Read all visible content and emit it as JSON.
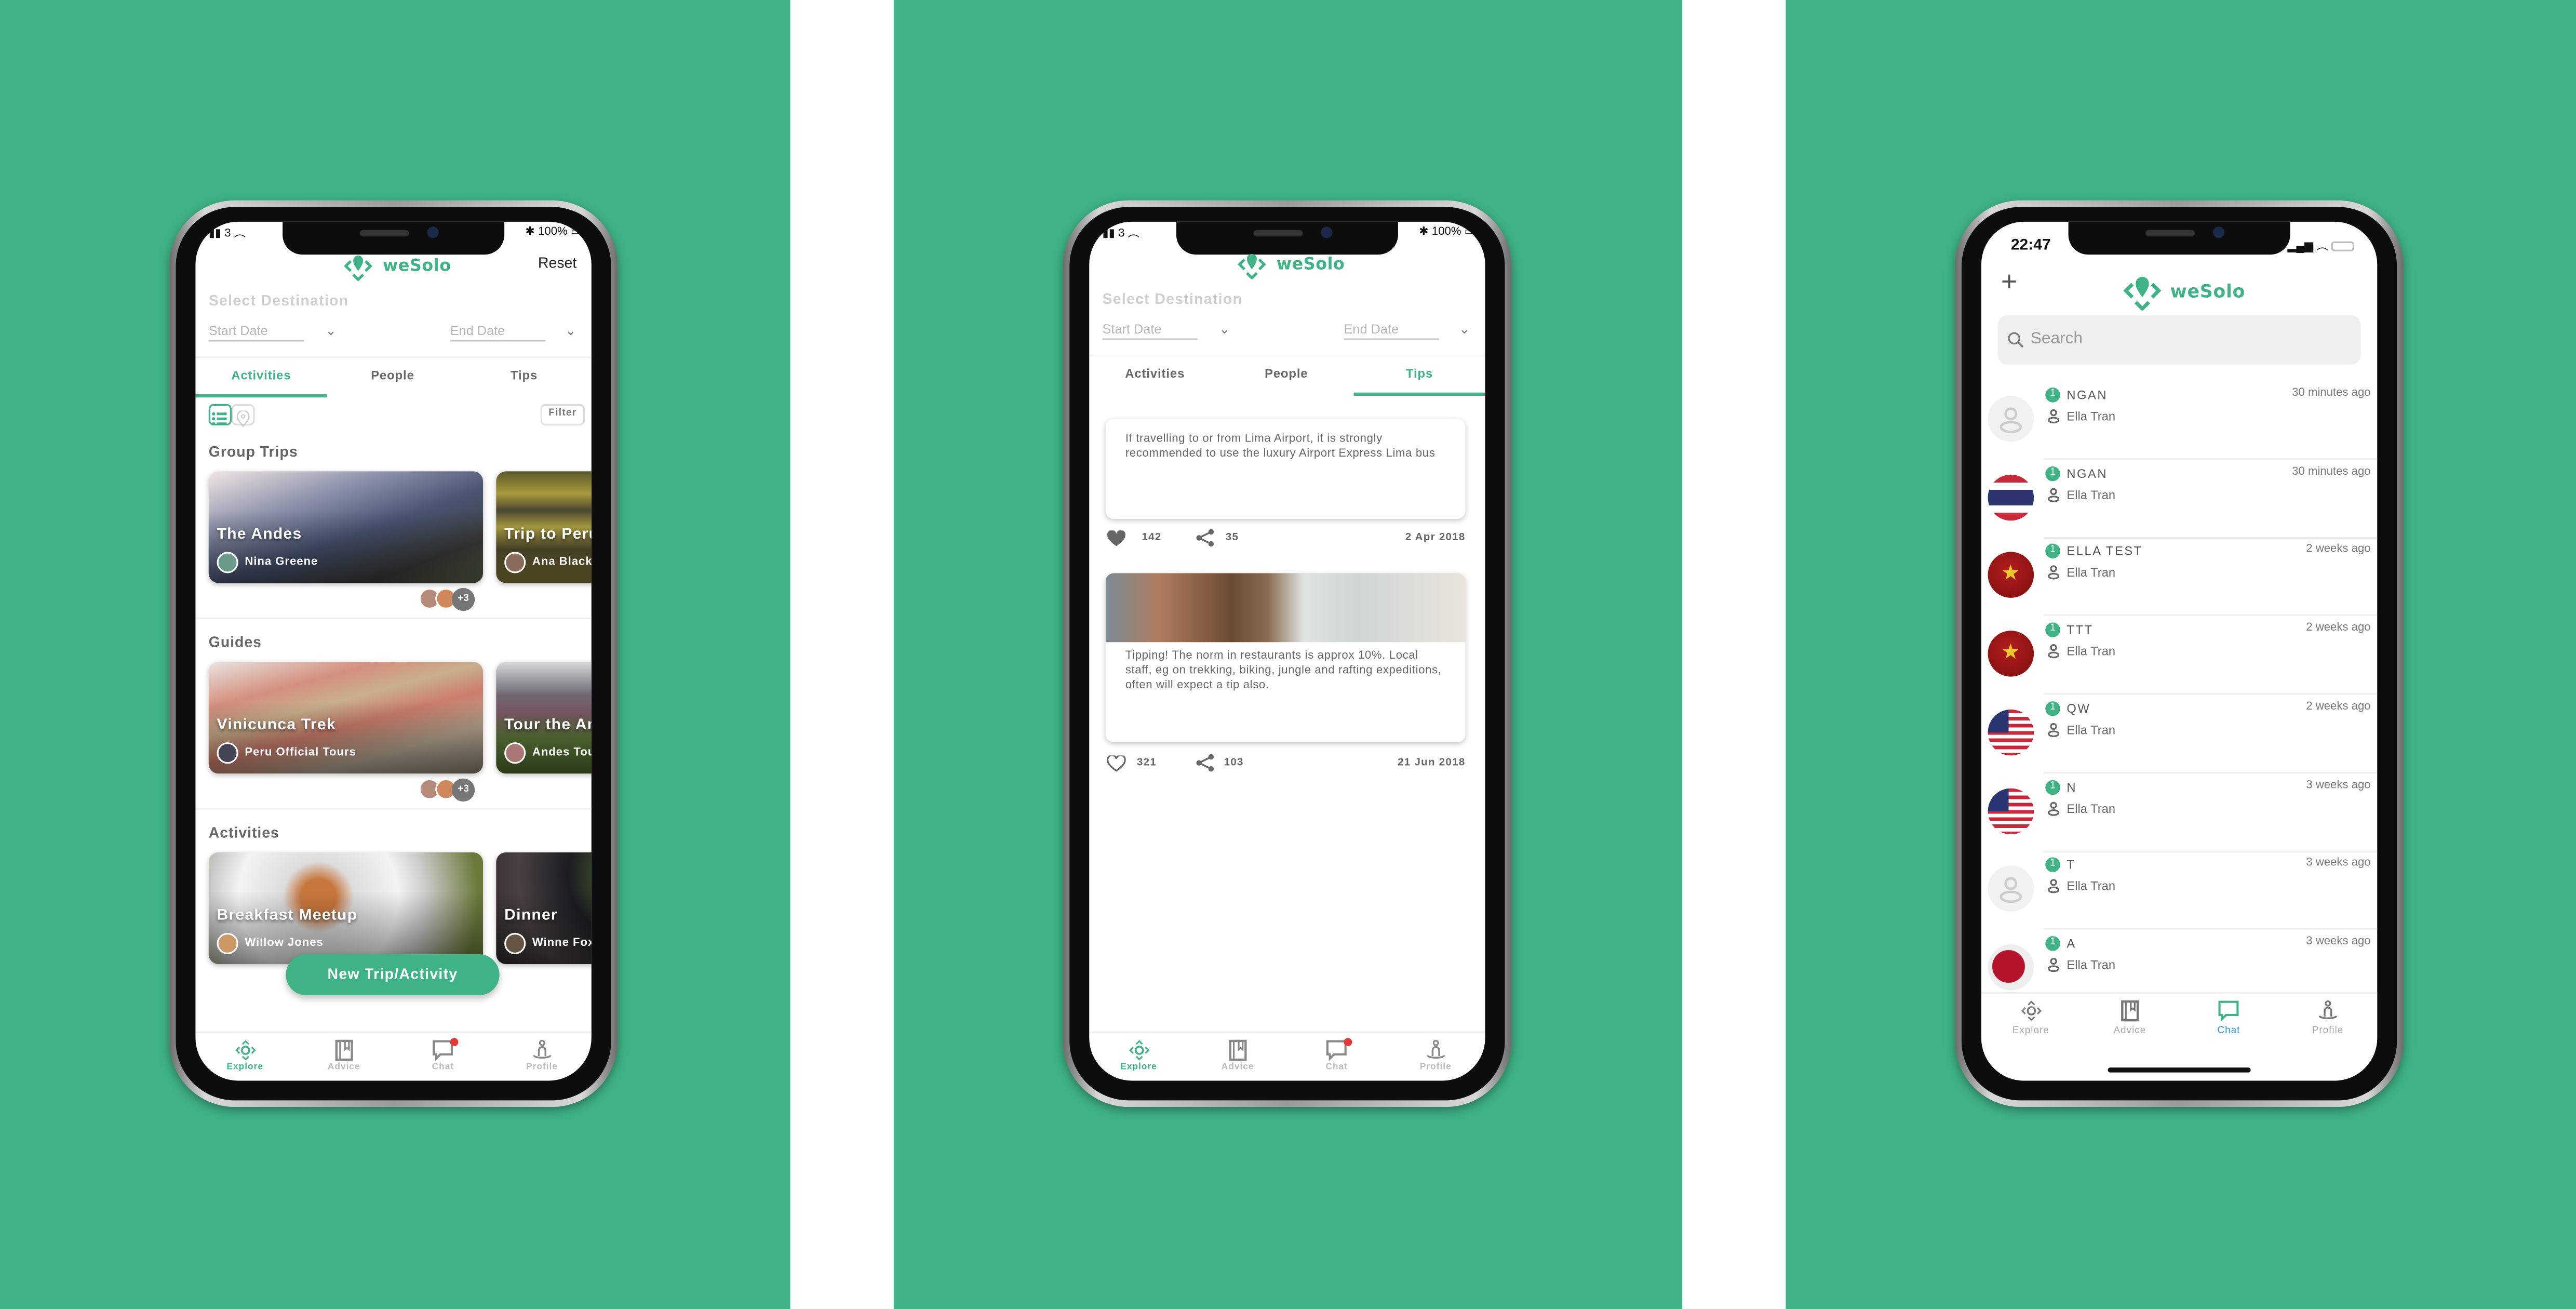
{
  "colors": {
    "brand": "#3fb386",
    "background": "#3fb386",
    "divider_strip": "#ffffff",
    "notification": "#e53935",
    "chat_active_label": "#2f8fd8"
  },
  "brand": {
    "logo_text": "weSolo",
    "logo_icon": "location-pin-arrows-icon"
  },
  "explore_screen": {
    "status": {
      "carrier": "3",
      "battery": "100%"
    },
    "reset_label": "Reset",
    "destination_placeholder": "Select Destination",
    "start_date_placeholder": "Start Date",
    "end_date_placeholder": "End Date",
    "tabs": [
      "Activities",
      "People",
      "Tips"
    ],
    "active_tab": "Activities",
    "view_toggle": {
      "active": "list"
    },
    "filter_label": "Filter",
    "sections": [
      {
        "title": "Group Trips",
        "cards": [
          {
            "title": "The Andes",
            "author": "Nina Greene"
          },
          {
            "title": "Trip to Peru",
            "author": "Ana Black"
          }
        ],
        "extra_members": "+3"
      },
      {
        "title": "Guides",
        "cards": [
          {
            "title": "Vinicunca Trek",
            "author": "Peru Official Tours"
          },
          {
            "title": "Tour the Andes",
            "author": "Andes Tours"
          }
        ],
        "extra_members": "+3"
      },
      {
        "title": "Activities",
        "cards": [
          {
            "title": "Breakfast Meetup",
            "author": "Willow Jones"
          },
          {
            "title": "Dinner",
            "author": "Winne Fox"
          }
        ]
      }
    ],
    "new_button": "New Trip/Activity"
  },
  "tips_screen": {
    "status": {
      "carrier": "3",
      "battery": "100%"
    },
    "destination_placeholder": "Select Destination",
    "start_date_placeholder": "Start Date",
    "end_date_placeholder": "End Date",
    "tabs": [
      "Activities",
      "People",
      "Tips"
    ],
    "active_tab": "Tips",
    "tips": [
      {
        "text": "If travelling to or from Lima Airport, it is strongly recommended to use the luxury Airport Express Lima bus",
        "likes": "142",
        "shares": "35",
        "date": "2 Apr 2018",
        "liked": true
      },
      {
        "text": "Tipping! The norm in restaurants is approx 10%. Local staff, eg on trekking, biking, jungle and rafting expeditions, often will expect a tip also.",
        "likes": "321",
        "shares": "103",
        "date": "21 Jun 2018",
        "liked": false,
        "has_image": true
      }
    ]
  },
  "nav": {
    "items": [
      "Explore",
      "Advice",
      "Chat",
      "Profile"
    ],
    "icons": [
      "explore-icon",
      "advice-book-icon",
      "chat-bubble-icon",
      "profile-icon"
    ]
  },
  "chat_screen": {
    "status": {
      "time": "22:47"
    },
    "search_placeholder": "Search",
    "active_nav": "Chat",
    "conversations": [
      {
        "name": "NGAN",
        "member": "Ella Tran",
        "time": "30 minutes ago",
        "unread": "1",
        "avatar": "placeholder"
      },
      {
        "name": "NGAN",
        "member": "Ella Tran",
        "time": "30 minutes ago",
        "unread": "1",
        "avatar": "flag-thailand"
      },
      {
        "name": "ELLA TEST",
        "member": "Ella Tran",
        "time": "2 weeks ago",
        "unread": "1",
        "avatar": "flag-vietnam"
      },
      {
        "name": "TTT",
        "member": "Ella Tran",
        "time": "2 weeks ago",
        "unread": "1",
        "avatar": "flag-vietnam"
      },
      {
        "name": "QW",
        "member": "Ella Tran",
        "time": "2 weeks ago",
        "unread": "1",
        "avatar": "flag-usa"
      },
      {
        "name": "N",
        "member": "Ella Tran",
        "time": "3 weeks ago",
        "unread": "1",
        "avatar": "flag-usa"
      },
      {
        "name": "T",
        "member": "Ella Tran",
        "time": "3 weeks ago",
        "unread": "1",
        "avatar": "placeholder"
      },
      {
        "name": "A",
        "member": "Ella Tran",
        "time": "3 weeks ago",
        "unread": "1",
        "avatar": "flag-japan"
      }
    ]
  }
}
